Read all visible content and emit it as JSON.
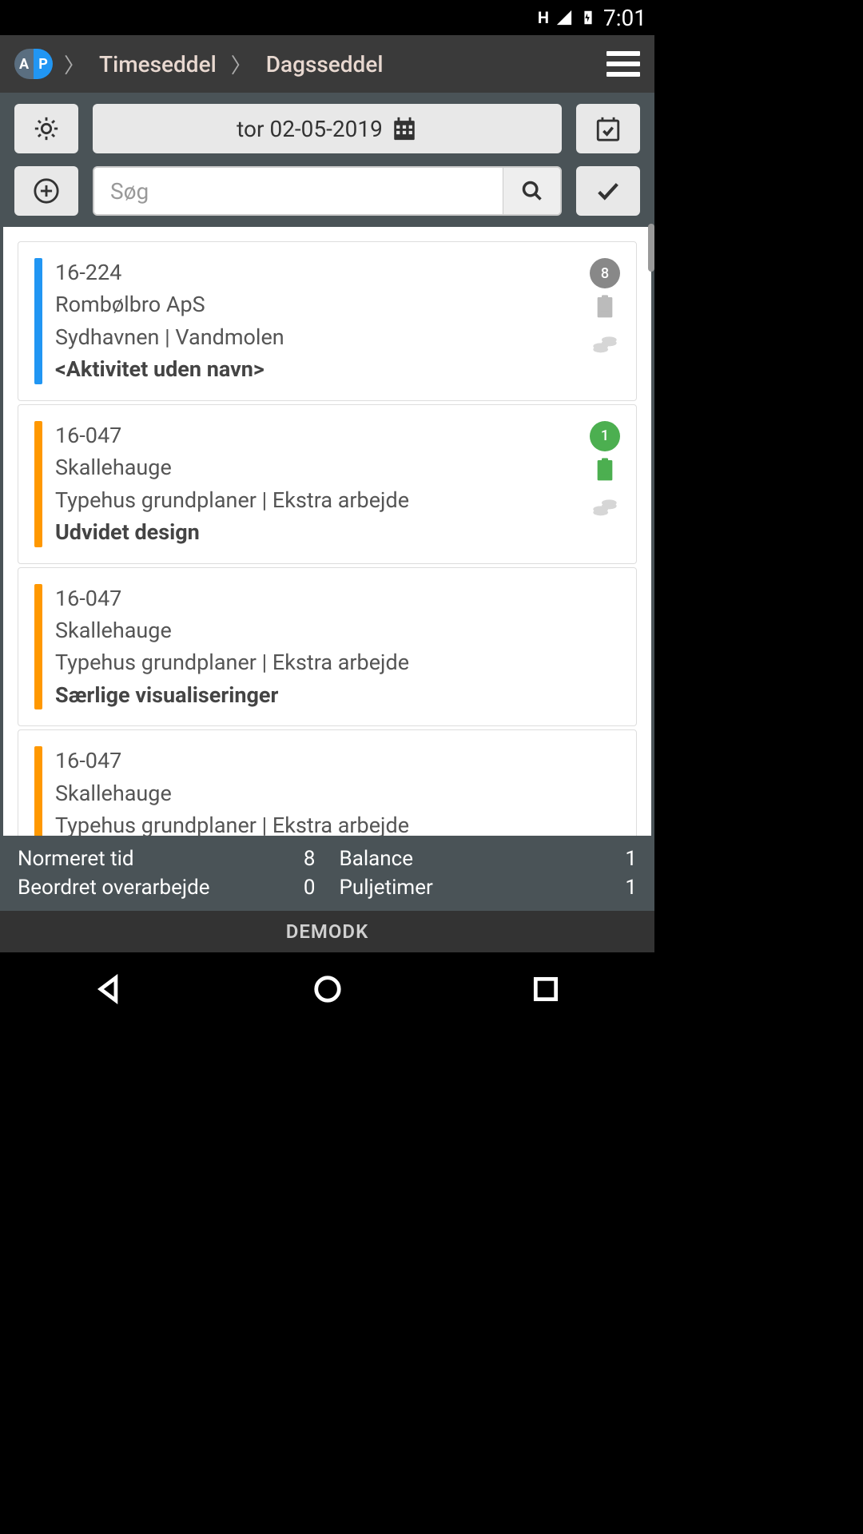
{
  "status": {
    "signal_label": "H",
    "time": "7:01"
  },
  "header": {
    "breadcrumb1": "Timeseddel",
    "breadcrumb2": "Dagsseddel"
  },
  "toolbar": {
    "date_display": "tor 02-05-2019",
    "search_placeholder": "Søg"
  },
  "cards": [
    {
      "bar_color": "blue",
      "code": "16-224",
      "client": "Rombølbro ApS",
      "project": "Sydhavnen | Vandmolen",
      "activity": "<Aktivitet uden navn>",
      "badge": "8",
      "badge_color": "gray",
      "clipboard_color": "gray"
    },
    {
      "bar_color": "orange",
      "code": "16-047",
      "client": "Skallehauge",
      "project": "Typehus grundplaner | Ekstra arbejde",
      "activity": "Udvidet design",
      "badge": "1",
      "badge_color": "green",
      "clipboard_color": "green"
    },
    {
      "bar_color": "orange",
      "code": "16-047",
      "client": "Skallehauge",
      "project": "Typehus grundplaner | Ekstra arbejde",
      "activity": "Særlige visualiseringer",
      "badge": null,
      "badge_color": null,
      "clipboard_color": null
    },
    {
      "bar_color": "orange",
      "code": "16-047",
      "client": "Skallehauge",
      "project": "Typehus grundplaner | Ekstra arbejde",
      "activity": "",
      "badge": null,
      "badge_color": null,
      "clipboard_color": null
    }
  ],
  "summary": {
    "col1_label1": "Normeret tid",
    "col1_value1": "8",
    "col1_label2": "Beordret overarbejde",
    "col1_value2": "0",
    "col2_label1": "Balance",
    "col2_value1": "1",
    "col2_label2": "Puljetimer",
    "col2_value2": "1"
  },
  "footer": {
    "banner": "DEMODK"
  }
}
